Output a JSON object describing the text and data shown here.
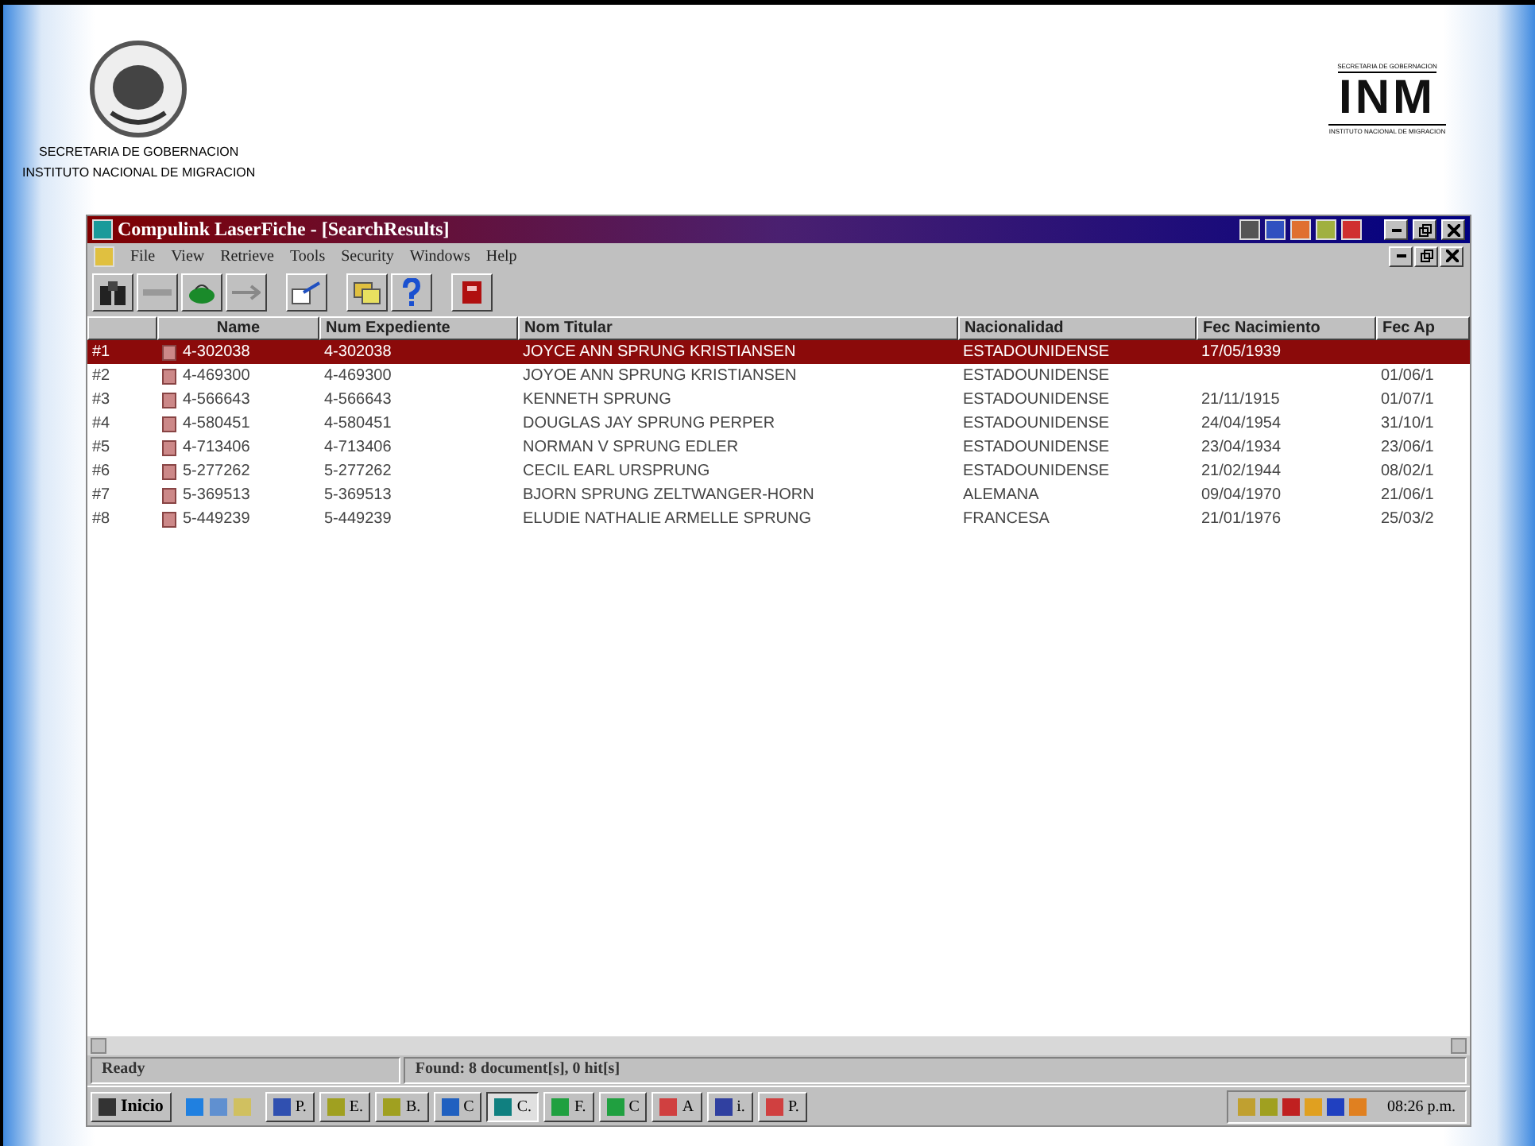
{
  "slide": {
    "left_logo": {
      "lines": [
        "SECRETARIA DE GOBERNACION",
        "INSTITUTO NACIONAL DE MIGRACION"
      ]
    },
    "right_logo": {
      "top": "SECRETARIA DE GOBERNACION",
      "mark": "INM",
      "bottom": "INSTITUTO NACIONAL DE MIGRACION"
    }
  },
  "window": {
    "title": "Compulink LaserFiche - [SearchResults]"
  },
  "menu": [
    "File",
    "View",
    "Retrieve",
    "Tools",
    "Security",
    "Windows",
    "Help"
  ],
  "table": {
    "columns": [
      "",
      "Name",
      "Num Expediente",
      "Nom Titular",
      "Nacionalidad",
      "Fec Nacimiento",
      "Fec Ap"
    ],
    "rows": [
      {
        "number": "#1",
        "name": "4-302038",
        "num_expediente": "4-302038",
        "nom_titular": "JOYCE ANN SPRUNG KRISTIANSEN",
        "nacionalidad": "ESTADOUNIDENSE",
        "fec_nacimiento": "17/05/1939",
        "selected": true
      },
      {
        "number": "#2",
        "name": "4-469300",
        "num_expediente": "4-469300",
        "nom_titular": "JOYOE ANN SPRUNG KRISTIANSEN",
        "nacionalidad": "ESTADOUNIDENSE",
        "column_7": "01/06/1",
        "selected": false
      },
      {
        "number": "#3",
        "name": "4-566643",
        "num_expediente": "4-566643",
        "nom_titular": "KENNETH SPRUNG",
        "nacionalidad": "ESTADOUNIDENSE",
        "fec_nacimiento": "21/11/1915",
        "column_7": "01/07/1",
        "selected": false
      },
      {
        "number": "#4",
        "name": "4-580451",
        "num_expediente": "4-580451",
        "nom_titular": "DOUGLAS JAY SPRUNG PERPER",
        "nacionalidad": "ESTADOUNIDENSE",
        "fec_nacimiento": "24/04/1954",
        "column_7": "31/10/1",
        "selected": false
      },
      {
        "number": "#5",
        "name": "4-713406",
        "num_expediente": "4-713406",
        "nom_titular": "NORMAN V SPRUNG EDLER",
        "nacionalidad": "ESTADOUNIDENSE",
        "fec_nacimiento": "23/04/1934",
        "column_7": "23/06/1",
        "selected": false
      },
      {
        "number": "#6",
        "name": "5-277262",
        "num_expediente": "5-277262",
        "nom_titular": "CECIL EARL URSPRUNG",
        "nacionalidad": "ESTADOUNIDENSE",
        "fec_nacimiento": "21/02/1944",
        "column_7": "08/02/1",
        "selected": false
      },
      {
        "number": "#7",
        "name": "5-369513",
        "num_expediente": "5-369513",
        "nom_titular": "BJORN SPRUNG ZELTWANGER-HORN",
        "nacionalidad": "ALEMANA",
        "fec_nacimiento": "09/04/1970",
        "column_7": "21/06/1",
        "selected": false
      },
      {
        "number": "#8",
        "name": "5-449239",
        "num_expediente": "5-449239",
        "nom_titular": "ELUDIE NATHALIE ARMELLE SPRUNG",
        "nacionalidad": "FRANCESA",
        "fec_nacimiento": "21/01/1976",
        "column_7": "25/03/2",
        "selected": false
      }
    ]
  },
  "status_bar": [
    "Ready",
    "Found: 8 document[s], 0 hit[s]"
  ],
  "taskbar": {
    "start": "Inicio",
    "buttons": [
      {
        "label": "P.",
        "color": "#3050b0",
        "selected": false
      },
      {
        "label": "E.",
        "color": "#a0a020",
        "selected": false
      },
      {
        "label": "B.",
        "color": "#a0a020",
        "selected": false
      },
      {
        "label": "C",
        "color": "#2060c0",
        "selected": false
      },
      {
        "label": "C.",
        "color": "#108080",
        "selected": true
      },
      {
        "label": "F.",
        "color": "#20a040",
        "selected": false
      },
      {
        "label": "C",
        "color": "#20a040",
        "selected": false
      },
      {
        "label": "A",
        "color": "#d04040",
        "selected": false
      },
      {
        "label": "i.",
        "color": "#3040a0",
        "selected": false
      },
      {
        "label": "P.",
        "color": "#d04040",
        "selected": false
      }
    ],
    "clock": "08:26 p.m."
  }
}
